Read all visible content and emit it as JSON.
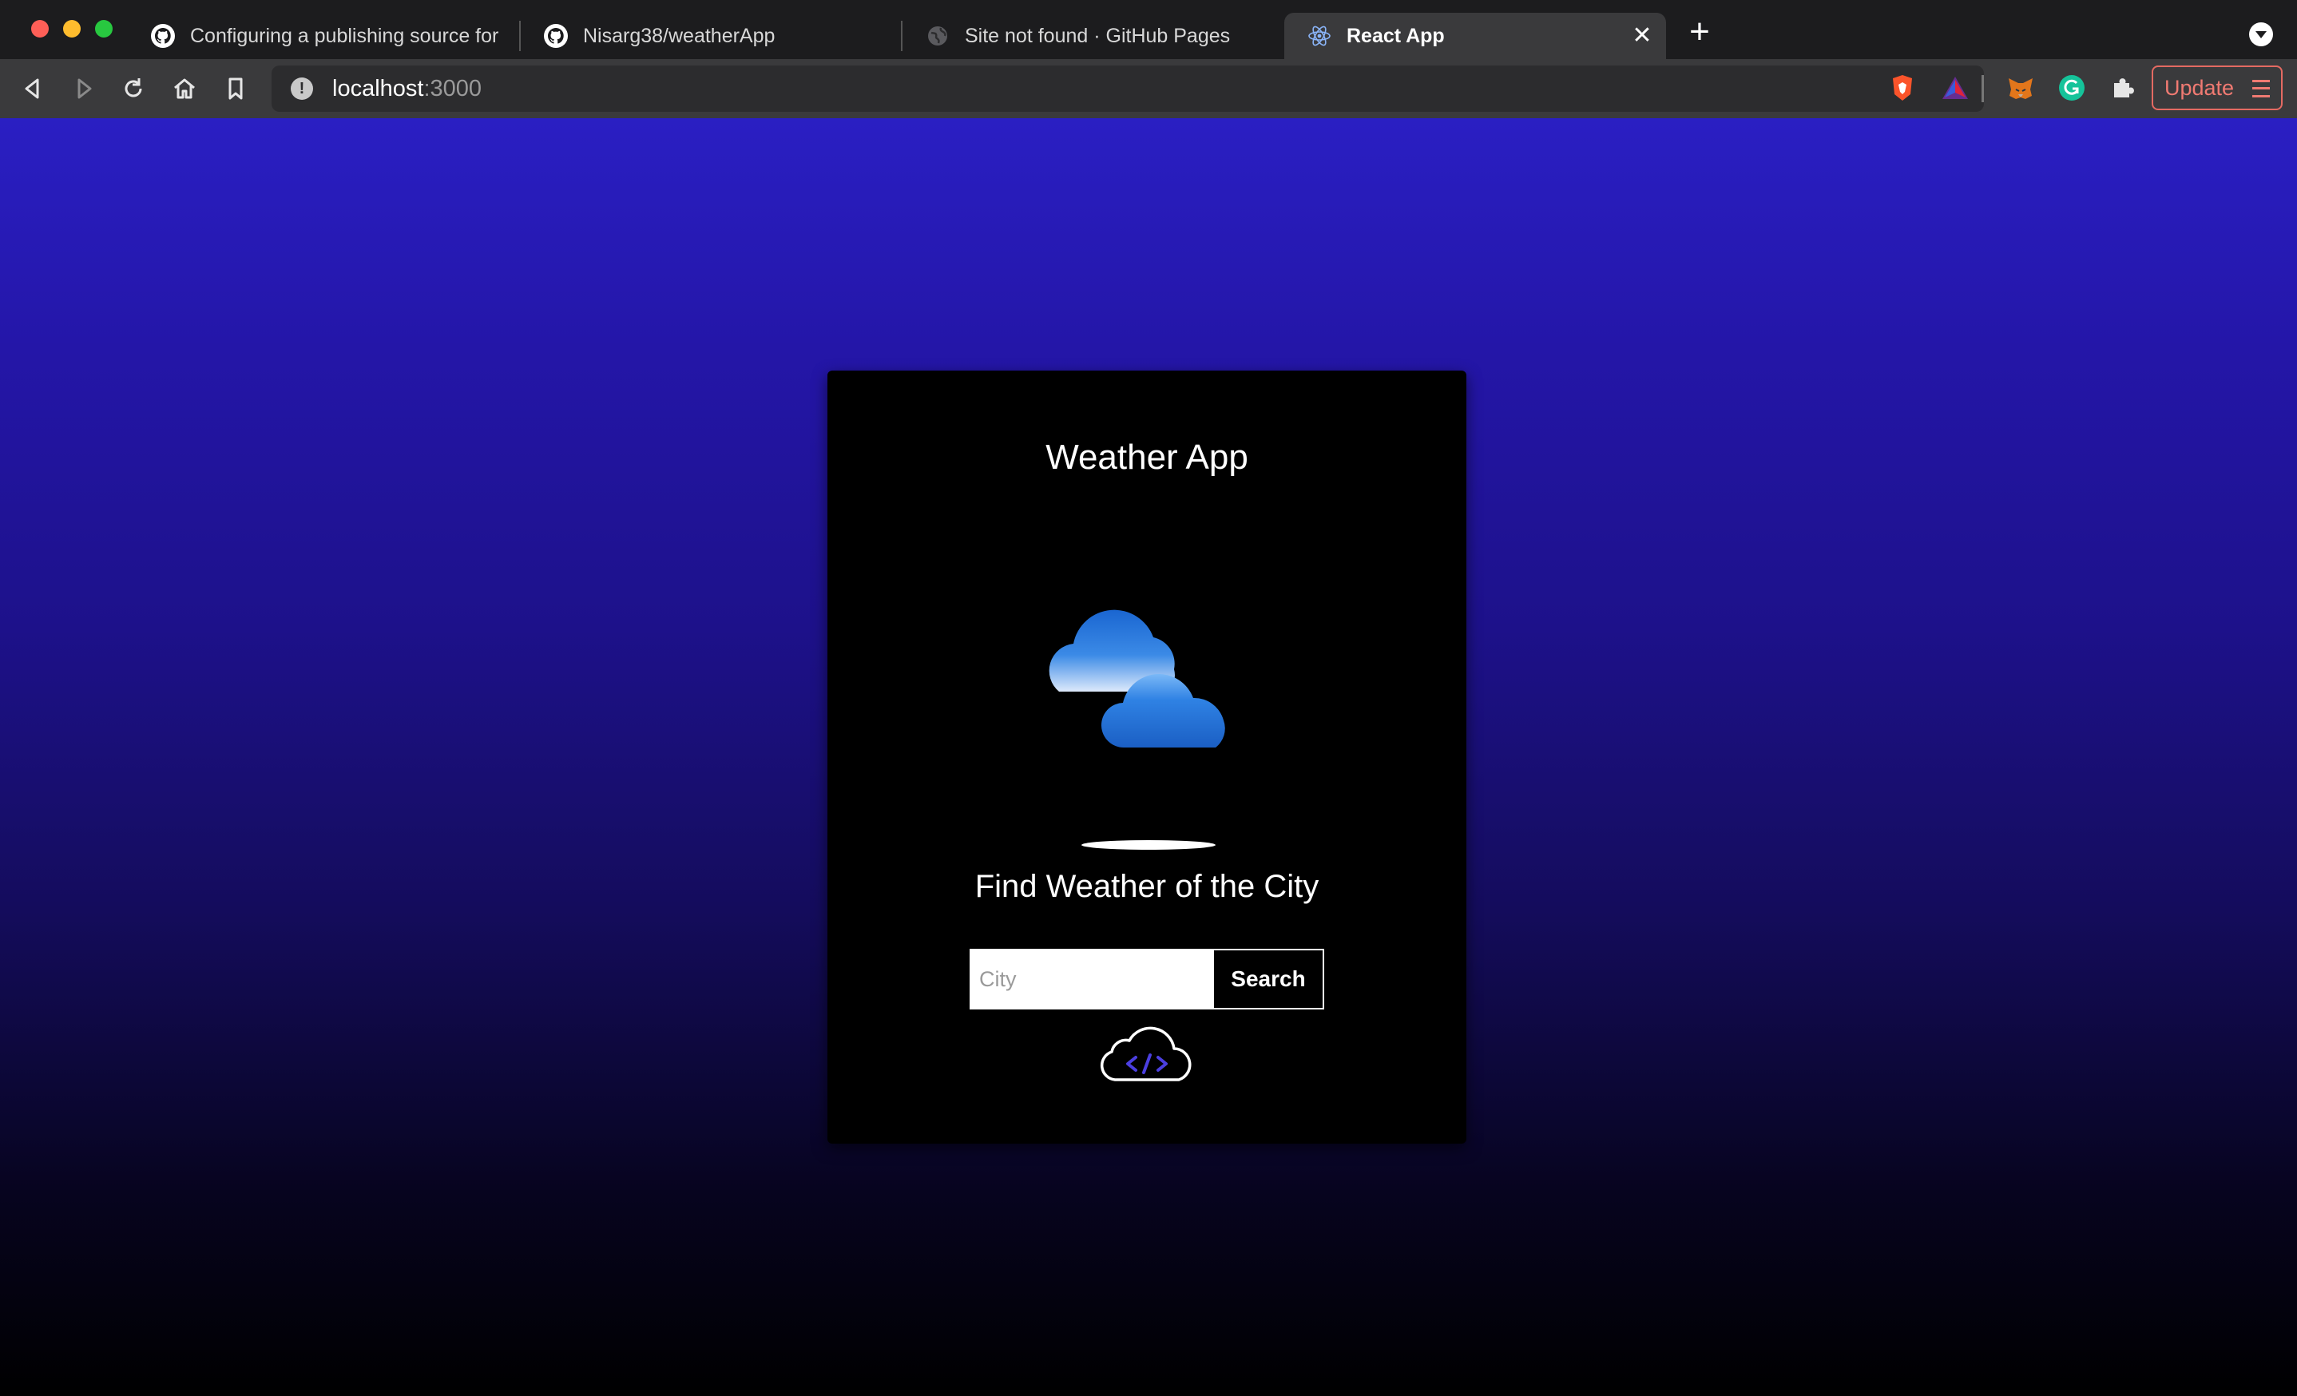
{
  "window": {
    "tabs": [
      {
        "title": "Configuring a publishing source for",
        "icon": "github-icon",
        "active": false
      },
      {
        "title": "Nisarg38/weatherApp",
        "icon": "github-icon",
        "active": false
      },
      {
        "title": "Site not found · GitHub Pages",
        "icon": "globe-icon",
        "active": false
      },
      {
        "title": "React App",
        "icon": "react-icon",
        "active": true
      }
    ],
    "close_glyph": "✕",
    "new_tab_glyph": "+"
  },
  "toolbar": {
    "url_host": "localhost",
    "url_port": ":3000",
    "info_glyph": "!",
    "update_label": "Update",
    "extensions": [
      "brave-shield-icon",
      "brave-rewards-icon",
      "metamask-icon",
      "grammarly-icon",
      "puzzle-icon"
    ]
  },
  "page": {
    "background_top": "#2a1fc3",
    "background_bottom": "#000000",
    "card": {
      "title": "Weather App",
      "subtitle": "Find Weather of the City",
      "search": {
        "placeholder": "City",
        "value": "",
        "button_label": "Search"
      },
      "hero_icon": "cloud-icon",
      "footer_icon": "code-cloud-icon"
    }
  }
}
